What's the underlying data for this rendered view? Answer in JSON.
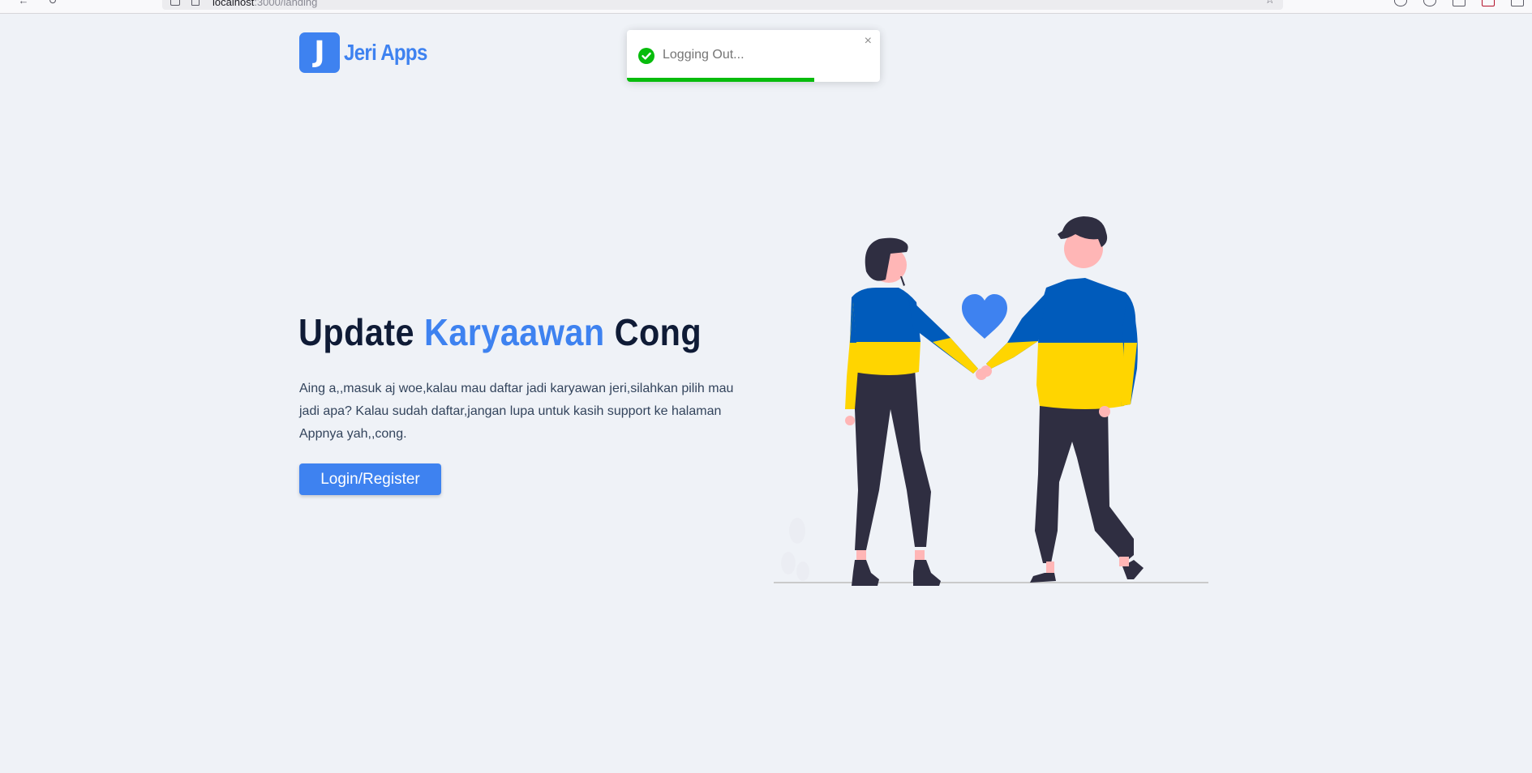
{
  "browser": {
    "url_host": "localhost",
    "url_rest": ":3000/landing"
  },
  "brand": {
    "logo_letter": "J",
    "name": "Jeri Apps",
    "color": "#3e82f0"
  },
  "toast": {
    "message": "Logging Out...",
    "close_symbol": "×",
    "status_color": "#07bc0c",
    "progress": 0.74
  },
  "hero": {
    "title_part1": "Update ",
    "title_accent": "Karyaawan",
    "title_part2": " Cong",
    "description": "Aing a,,masuk aj woe,kalau mau daftar jadi karyawan jeri,silahkan pilih mau jadi apa? Kalau sudah daftar,jangan lupa untuk kasih support ke halaman Appnya yah,,cong.",
    "cta_label": "Login/Register"
  },
  "illustration": {
    "sweater_top": "#005bbb",
    "sweater_bottom": "#ffd500",
    "heart_color": "#3e82f0",
    "pants_color": "#2f2e41",
    "skin_color": "#ffb6b6"
  }
}
